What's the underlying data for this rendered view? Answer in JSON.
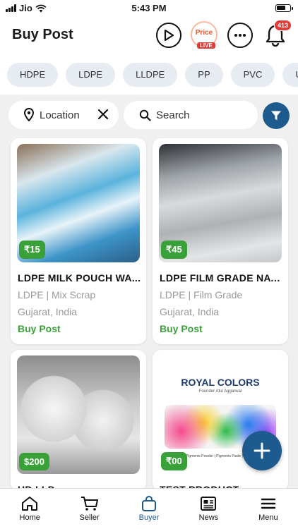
{
  "status_bar": {
    "carrier": "Jio",
    "time": "5:43 PM"
  },
  "header": {
    "title": "Buy Post",
    "price_live_label": "Price",
    "live_tag": "LIVE",
    "notification_count": "413"
  },
  "categories": [
    "HDPE",
    "LDPE",
    "LLDPE",
    "PP",
    "PVC",
    "UPVC"
  ],
  "filters": {
    "location_label": "Location",
    "search_placeholder": "Search"
  },
  "posts": [
    {
      "price": "₹15",
      "title": "LDPE MILK POUCH WA...",
      "meta": "LDPE | Mix Scrap",
      "location": "Gujarat, India",
      "action": "Buy Post"
    },
    {
      "price": "₹45",
      "title": "LDPE FILM GRADE NAT...",
      "meta": "LDPE | Film Grade",
      "location": "Gujarat, India",
      "action": "Buy Post"
    },
    {
      "price": "$200",
      "title": "HD LLD..."
    },
    {
      "price": "₹00",
      "title": "TEST PRODUCT",
      "image_text": {
        "brand": "ROYAL COLORS",
        "founder": "Founder Atul Aggarwal",
        "footer": "All Types of : Pigments Powder | Pigments Paste | Carbon Titanium"
      }
    }
  ],
  "bottom_nav": [
    {
      "label": "Home",
      "icon": "home-icon"
    },
    {
      "label": "Seller",
      "icon": "cart-icon"
    },
    {
      "label": "Buyer",
      "icon": "bag-icon"
    },
    {
      "label": "News",
      "icon": "newspaper-icon"
    },
    {
      "label": "Menu",
      "icon": "menu-icon"
    }
  ],
  "colors": {
    "accent": "#1d5a8d",
    "price_green": "#3aa03a",
    "badge_red": "#e03b36"
  }
}
